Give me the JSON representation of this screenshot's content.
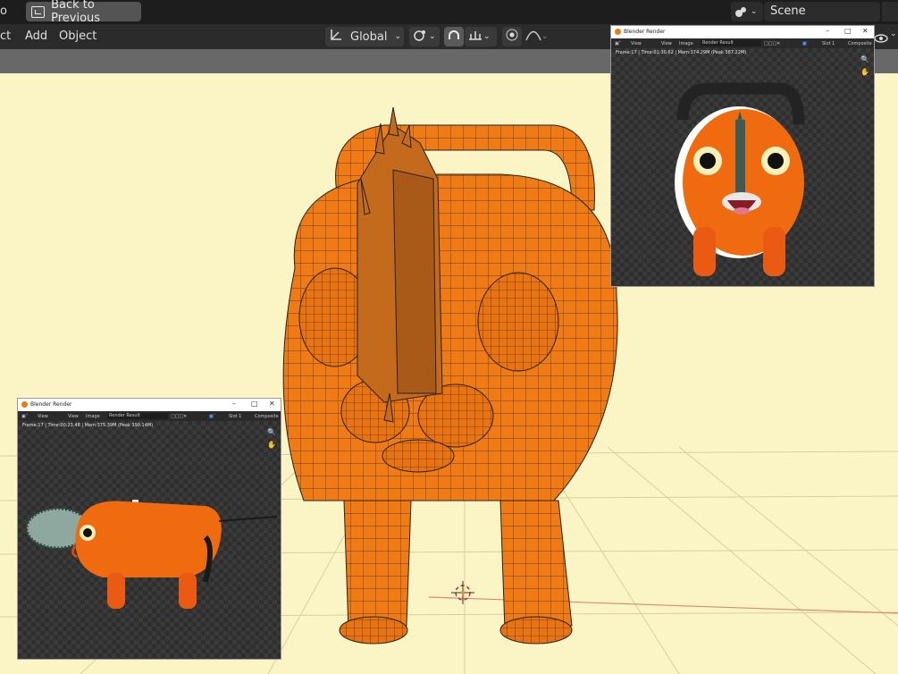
{
  "topbar": {
    "left_glyph": "o",
    "back_label": "Back to Previous",
    "scene_label": "Scene"
  },
  "menubar": {
    "items": [
      "ct",
      "Add",
      "Object"
    ],
    "transform_orientation": "Global"
  },
  "render_windows": [
    {
      "title": "Blender Render",
      "menu": [
        "View",
        "View",
        "Image"
      ],
      "image_field": "Render Result",
      "slot": "Slot 1",
      "layer": "Composite",
      "stats": "Frame:17 | Time:01:30.62 | Mem:374.29M (Peak 387.22M)"
    },
    {
      "title": "Blender Render",
      "menu": [
        "View",
        "View",
        "Image"
      ],
      "image_field": "Render Result",
      "slot": "Slot 1",
      "layer": "Composite",
      "stats": "Frame:17 | Time:00:23.48 | Mem:375.39M (Peak 390.14M)"
    }
  ],
  "colors": {
    "viewport_bg": "#fbf4c4",
    "mesh_orange": "#f07b14",
    "accent": "#e87d0d"
  }
}
